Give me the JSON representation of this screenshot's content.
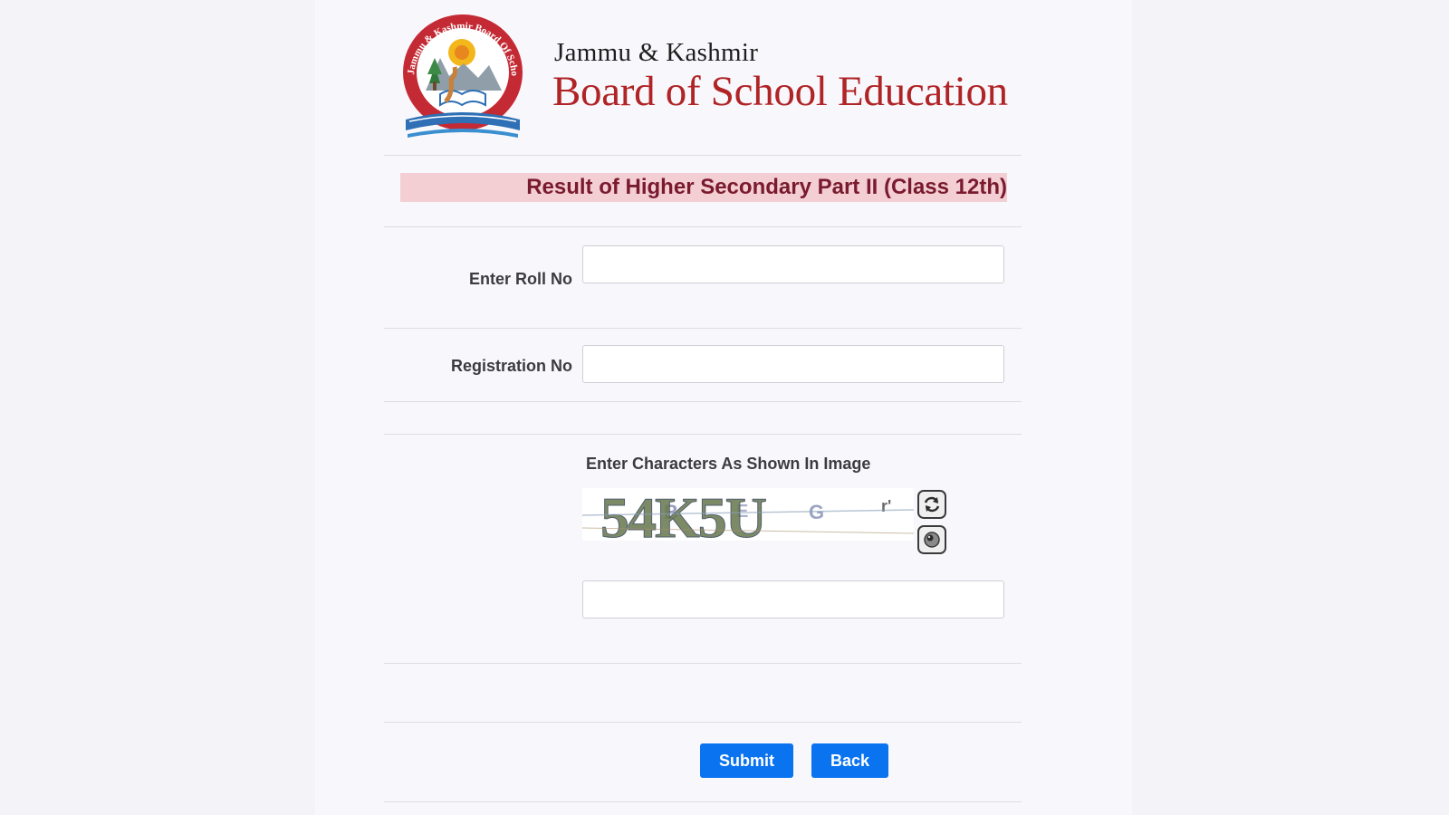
{
  "header": {
    "line1": "Jammu & Kashmir",
    "line2": "Board of School Education",
    "logo_text": "Jammu & Kashmir Board Of School Education",
    "logo_colors": {
      "ring": "#c42a34",
      "sun": "#f3b71c",
      "book": "#2e6fb5"
    }
  },
  "title": "Result of Higher Secondary Part II (Class 12th)",
  "form": {
    "roll_no": {
      "label": "Enter Roll No",
      "value": "",
      "placeholder": ""
    },
    "registration_no": {
      "label": "Registration No",
      "value": "",
      "placeholder": ""
    },
    "captcha": {
      "label": "Enter Characters As Shown In Image",
      "image_text": "54K5U",
      "refresh_icon": "refresh-icon",
      "audio_icon": "audio-icon",
      "value": "",
      "placeholder": ""
    }
  },
  "buttons": {
    "submit": "Submit",
    "back": "Back"
  },
  "colors": {
    "accent": "#0a73f0",
    "brand": "#b02426",
    "title_bg": "#f3cfd3",
    "title_text": "#7a1a2e"
  }
}
